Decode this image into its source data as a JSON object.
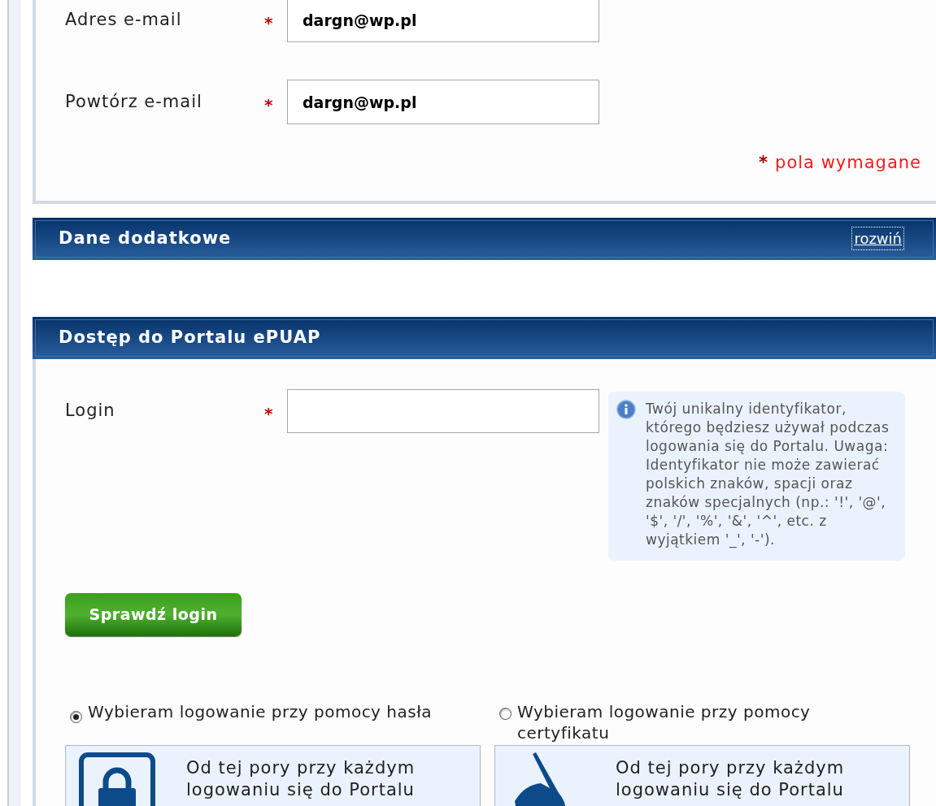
{
  "contact_fields": [
    {
      "label": "Adres e-mail",
      "required_mark": "*",
      "value": "dargn@wp.pl"
    },
    {
      "label": "Powtórz e-mail",
      "required_mark": "*",
      "value": "dargn@wp.pl"
    }
  ],
  "required_note": {
    "mark": "*",
    "text": "pola wymagane"
  },
  "additional_section": {
    "title": "Dane dodatkowe",
    "toggle": "rozwiń",
    "focused": true
  },
  "access_section": {
    "title": "Dostęp do Portalu ePUAP",
    "login_field": {
      "label": "Login",
      "required_mark": "*"
    },
    "hint": "Twój unikalny identyfikator, którego będziesz używał podczas logowania się do Portalu. Uwaga: Identyfikator nie może zawierać polskich znaków, spacji oraz znaków specjalnych (np.: '!', '@', '$', '/', '%', '&', '^', etc. z wyjątkiem '_', '-').",
    "check_button": "Sprawdź login",
    "login_options": [
      {
        "kind": "password",
        "label": "Wybieram logowanie przy pomocy hasła",
        "selected": true,
        "description": "Od tej pory przy każdym logowaniu się do Portalu"
      },
      {
        "kind": "certificate",
        "label": "Wybieram logowanie przy pomocy certyfikatu",
        "selected": false,
        "description": "Od tej pory przy każdym logowaniu się do Portalu"
      }
    ]
  }
}
